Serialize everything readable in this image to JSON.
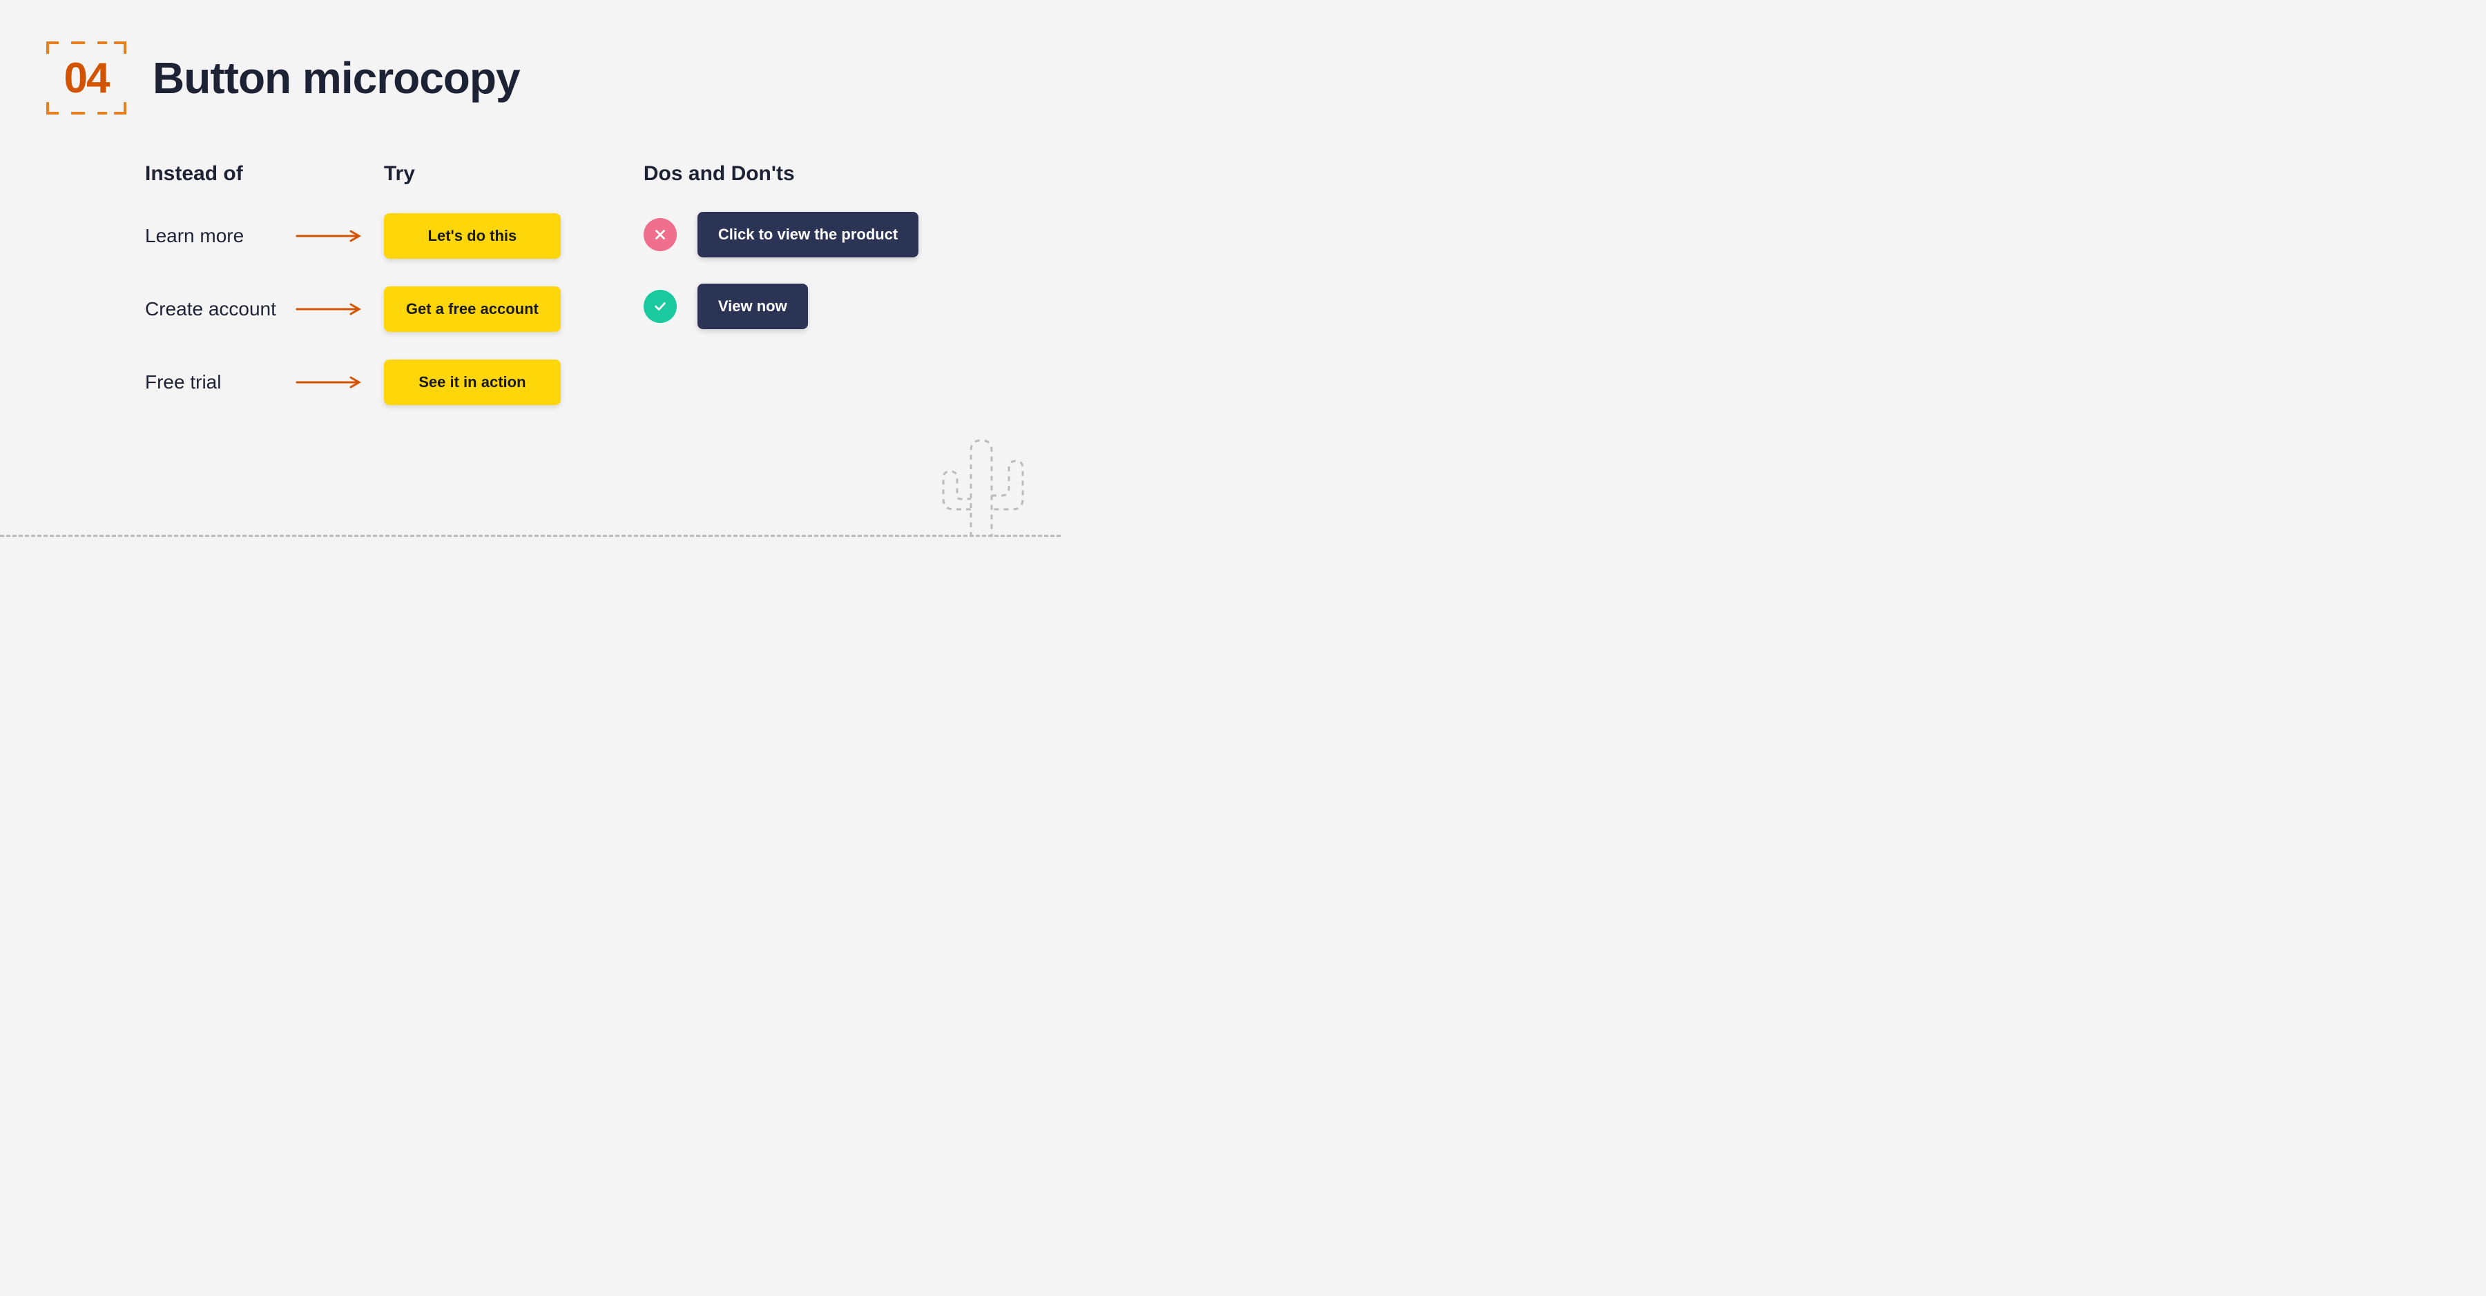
{
  "header": {
    "number": "04",
    "title": "Button microcopy"
  },
  "compare": {
    "col_instead": "Instead of",
    "col_try": "Try",
    "rows": [
      {
        "instead": "Learn more",
        "try": "Let's do this"
      },
      {
        "instead": "Create account",
        "try": "Get a free account"
      },
      {
        "instead": "Free trial",
        "try": "See it in action"
      }
    ]
  },
  "dos": {
    "heading": "Dos and Don'ts",
    "bad": "Click to view the product",
    "good": "View now"
  },
  "colors": {
    "accent": "#e67e22",
    "yellow": "#ffd60a",
    "navy": "#2c3455",
    "pink": "#ef6e8b",
    "green": "#1bc9a0"
  }
}
